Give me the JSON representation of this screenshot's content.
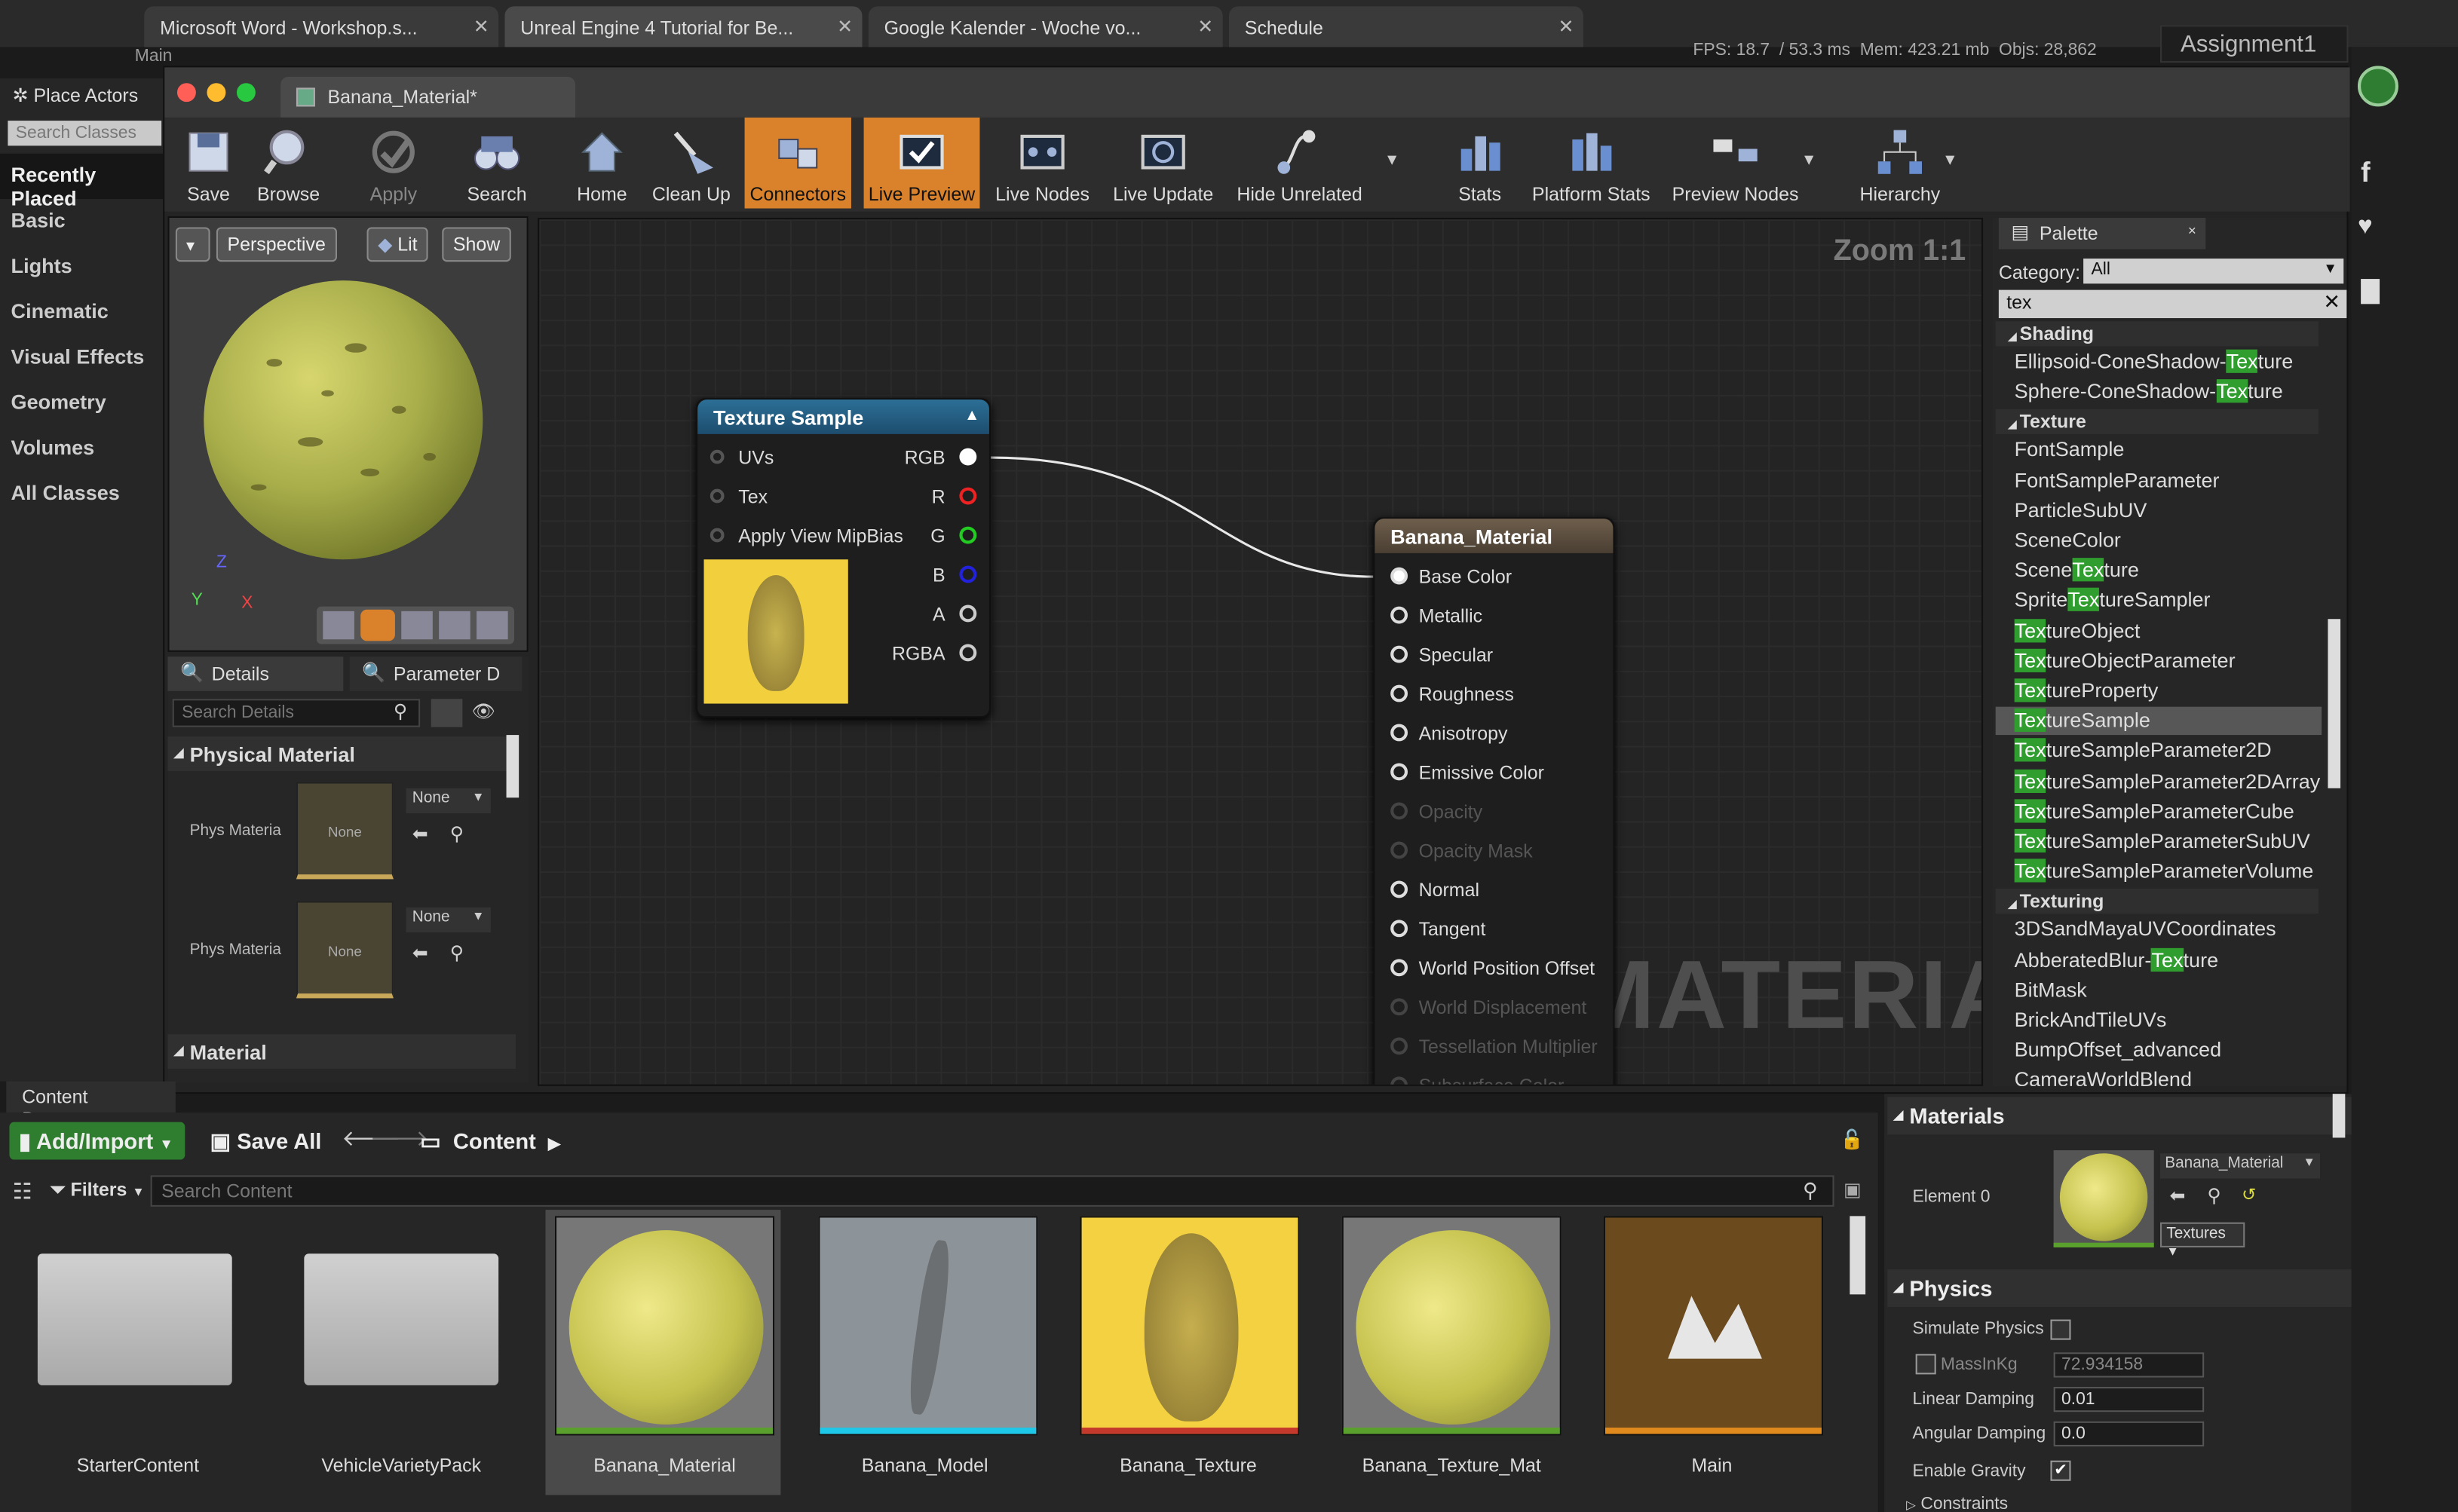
{
  "browser": {
    "tabs": [
      "Microsoft Word - Workshop.s...",
      "Unreal Engine 4 Tutorial for Be...",
      "Google Kalender - Woche vo...",
      "Schedule"
    ],
    "window_label": "Main",
    "stats_fps": "FPS: 18.7",
    "stats_ms": "53.3 ms",
    "stats_mem": "Mem: 423.21 mb",
    "stats_objs": "Objs: 28,862",
    "project": "Assignment1"
  },
  "place_actors": {
    "title": "Place Actors",
    "search_placeholder": "Search Classes",
    "items": [
      "Recently Placed",
      "Basic",
      "Lights",
      "Cinematic",
      "Visual Effects",
      "Geometry",
      "Volumes",
      "All Classes"
    ]
  },
  "editor": {
    "tab_title": "Banana_Material*",
    "toolbar": [
      "Save",
      "Browse",
      "Apply",
      "Search",
      "Home",
      "Clean Up",
      "Connectors",
      "Live Preview",
      "Live Nodes",
      "Live Update",
      "Hide Unrelated",
      "Stats",
      "Platform Stats",
      "Preview Nodes",
      "Hierarchy"
    ],
    "active_toolbar": [
      "Connectors",
      "Live Preview"
    ]
  },
  "viewport": {
    "perspective": "Perspective",
    "lit": "Lit",
    "show": "Show",
    "axis_z": "Z",
    "axis_y": "Y",
    "axis_x": "X"
  },
  "details": {
    "tab_details": "Details",
    "tab_params": "Parameter D",
    "search_placeholder": "Search Details",
    "section_physical": "Physical Material",
    "phys_label": "Phys Materia",
    "none": "None",
    "section_material": "Material"
  },
  "graph": {
    "zoom": "Zoom 1:1",
    "watermark": "MATERIAL",
    "texture_node": {
      "title": "Texture Sample",
      "inputs": [
        "UVs",
        "Tex",
        "Apply View MipBias"
      ],
      "outputs": [
        "RGB",
        "R",
        "G",
        "B",
        "A",
        "RGBA"
      ]
    },
    "material_node": {
      "title": "Banana_Material",
      "inputs": [
        "Base Color",
        "Metallic",
        "Specular",
        "Roughness",
        "Anisotropy",
        "Emissive Color",
        "Opacity",
        "Opacity Mask",
        "Normal",
        "Tangent",
        "World Position Offset",
        "World Displacement",
        "Tessellation Multiplier",
        "Subsurface Color"
      ],
      "disabled": [
        "Opacity",
        "Opacity Mask",
        "World Displacement",
        "Tessellation Multiplier",
        "Subsurface Color"
      ]
    }
  },
  "palette": {
    "title": "Palette",
    "category_label": "Category:",
    "category_value": "All",
    "search_value": "tex",
    "categories": {
      "shading": "Shading",
      "texture": "Texture",
      "texturing": "Texturing"
    },
    "shading_items": [
      [
        "Ellipsoid-ConeShadow-",
        "Tex",
        "ture"
      ],
      [
        "Sphere-ConeShadow-",
        "Tex",
        "ture"
      ]
    ],
    "texture_items": [
      [
        "FontSample",
        "",
        ""
      ],
      [
        "FontSampleParameter",
        "",
        ""
      ],
      [
        "ParticleSubUV",
        "",
        ""
      ],
      [
        "SceneColor",
        "",
        ""
      ],
      [
        "Scene",
        "Tex",
        "ture"
      ],
      [
        "Sprite",
        "Tex",
        "tureSampler"
      ],
      [
        "",
        "Tex",
        "tureObject"
      ],
      [
        "",
        "Tex",
        "tureObjectParameter"
      ],
      [
        "",
        "Tex",
        "tureProperty"
      ],
      [
        "",
        "Tex",
        "tureSample"
      ],
      [
        "",
        "Tex",
        "tureSampleParameter2D"
      ],
      [
        "",
        "Tex",
        "tureSampleParameter2DArray"
      ],
      [
        "",
        "Tex",
        "tureSampleParameterCube"
      ],
      [
        "",
        "Tex",
        "tureSampleParameterSubUV"
      ],
      [
        "",
        "Tex",
        "tureSampleParameterVolume"
      ]
    ],
    "texturing_items": [
      [
        "3DSandMayaUVCoordinates",
        "",
        ""
      ],
      [
        "AbberatedBlur-",
        "Tex",
        "ture"
      ],
      [
        "BitMask",
        "",
        ""
      ],
      [
        "BrickAndTileUVs",
        "",
        ""
      ],
      [
        "BumpOffset_advanced",
        "",
        ""
      ],
      [
        "CameraWorldBlend",
        "",
        ""
      ]
    ],
    "selected": "TextureSample"
  },
  "content_browser": {
    "tab": "Content Browser",
    "add_import": "Add/Import",
    "save_all": "Save All",
    "path": "Content",
    "filters": "Filters",
    "search_placeholder": "Search Content",
    "assets": [
      "StarterContent",
      "VehicleVarietyPack",
      "Banana_Material",
      "Banana_Model",
      "Banana_Texture",
      "Banana_Texture_Mat",
      "Main"
    ],
    "selected_asset": "Banana_Material"
  },
  "mesh_details": {
    "materials_section": "Materials",
    "element": "Element 0",
    "material_value": "Banana_Material",
    "textures": "Textures",
    "physics_section": "Physics",
    "simulate_physics": "Simulate Physics",
    "mass": "MassInKg",
    "mass_value": "72.934158",
    "linear_damping": "Linear Damping",
    "linear_damping_value": "0.01",
    "angular_damping": "Angular Damping",
    "angular_damping_value": "0.0",
    "enable_gravity": "Enable Gravity",
    "constraints": "Constraints"
  }
}
